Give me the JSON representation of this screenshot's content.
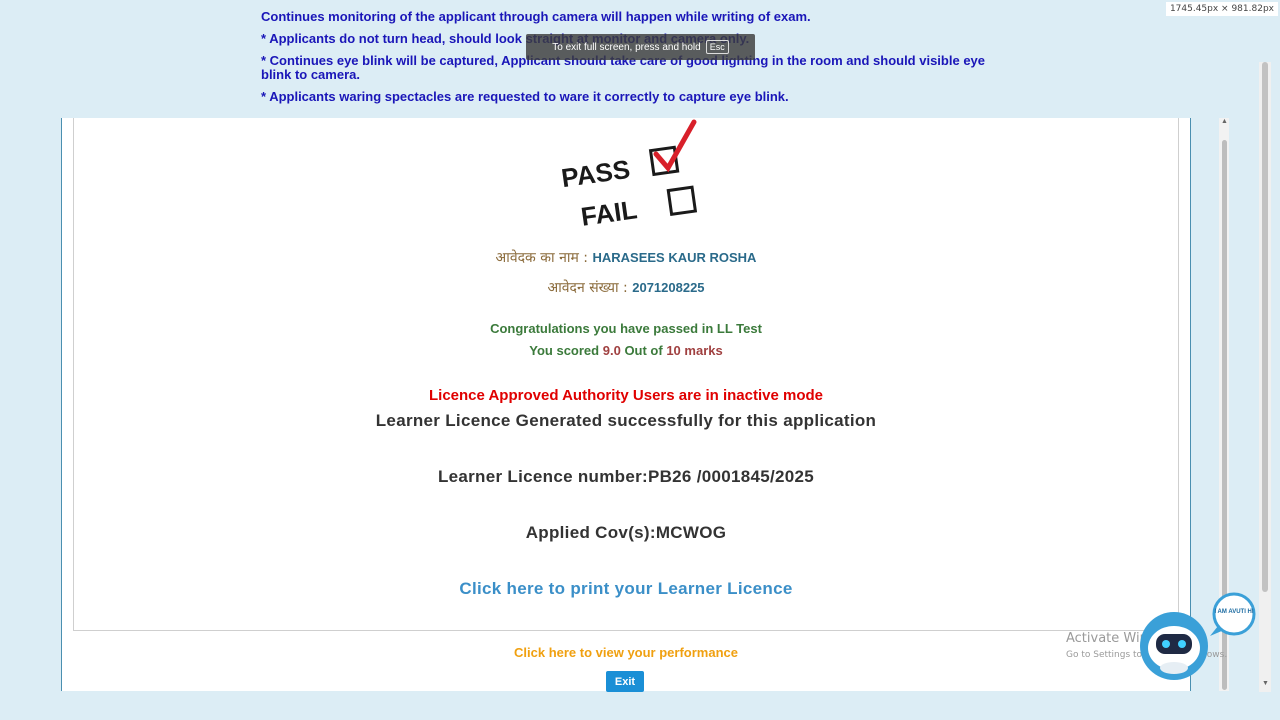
{
  "instructions": {
    "line1": "Continues monitoring of the applicant through camera will happen while writing of exam.",
    "line2": "* Applicants do not turn head, should look straight at monitor and camera only.",
    "line3": "* Continues eye blink will be captured, Applicant should take care of good lighting in the room and should visible eye blink to camera.",
    "line4": "* Applicants waring spectacles are requested to ware it correctly to capture eye blink."
  },
  "fullscreen_toast": {
    "text": "To exit full screen, press and hold",
    "key": "Esc"
  },
  "dimension_badge": "1745.45px × 981.82px",
  "pass_fail_image": {
    "pass": "PASS",
    "fail": "FAIL",
    "pass_checked": true
  },
  "applicant": {
    "name_label": "आवेदक का नाम :",
    "name": "HARASEES KAUR ROSHA",
    "app_no_label": "आवेदन संख्या :",
    "app_no": "2071208225"
  },
  "result": {
    "congrats": "Congratulations you have passed in LL Test",
    "score_prefix": "You scored",
    "score": "9.0",
    "score_mid": "Out of",
    "max_marks": "10 marks"
  },
  "status": {
    "authority_msg": "Licence Approved Authority Users are in inactive mode",
    "generated_msg": "Learner Licence Generated successfully for this application",
    "licence_number": "Learner Licence number:PB26 /0001845/2025",
    "cov": "Applied Cov(s):MCWOG"
  },
  "links": {
    "print": "Click here to print your Learner Licence",
    "performance": "Click here to view your performance",
    "exit": "Exit"
  },
  "watermark": {
    "line1": "Activate Windows",
    "line2": "Go to Settings to activate Windows."
  },
  "chatbot": {
    "bubble_text": "I AM AVUTI HI"
  }
}
